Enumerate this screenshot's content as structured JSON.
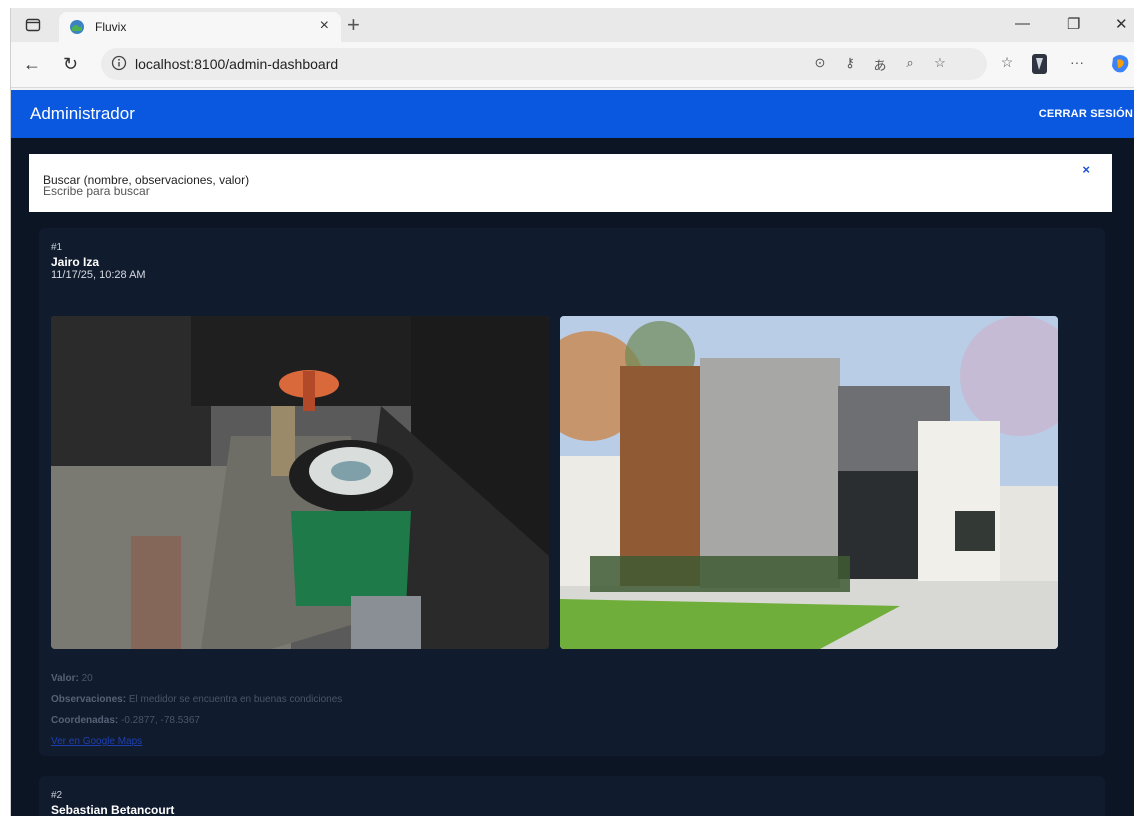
{
  "browser": {
    "tab_title": "Fluvix",
    "tab_close": "×",
    "new_tab": "+",
    "url": "localhost:8100/admin-dashboard",
    "win_min": "—",
    "win_max": "❐",
    "win_close": "✕",
    "more": "···"
  },
  "app": {
    "title": "Administrador",
    "logout_label": "CERRAR SESIÓN",
    "search": {
      "label": "Buscar (nombre, observaciones, valor)",
      "placeholder": "Escribe para buscar",
      "clear": "×"
    }
  },
  "records": [
    {
      "num": "#1",
      "name": "Jairo Iza",
      "date": "11/17/25, 10:28 AM",
      "valor_label": "Valor:",
      "valor": "20",
      "obs_label": "Observaciones:",
      "obs": "El medidor se encuentra en buenas condiciones",
      "coord_label": "Coordenadas:",
      "coord": "-0.2877, -78.5367",
      "map_link": "Ver en Google Maps"
    },
    {
      "num": "#2",
      "name": "Sebastian Betancourt"
    }
  ],
  "colors": {
    "header": "#0a57e0",
    "background": "#0c1524",
    "card": "#101b2e"
  }
}
